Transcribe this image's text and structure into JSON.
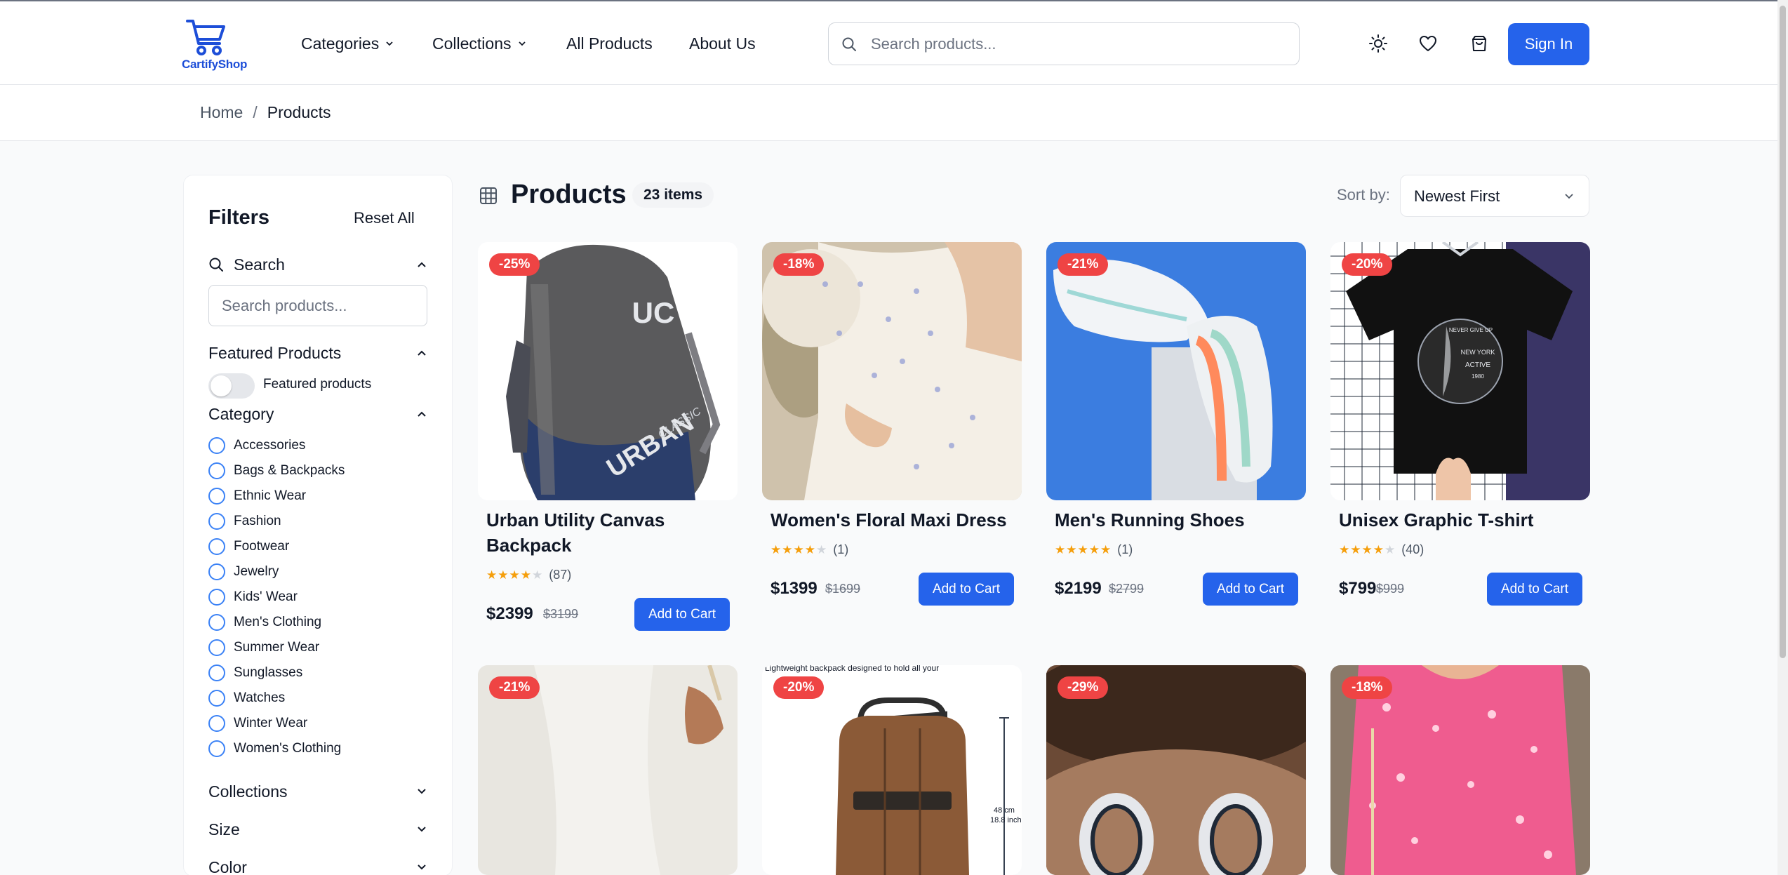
{
  "brand": {
    "name": "CartifyShop",
    "accent": "#2563eb"
  },
  "nav": {
    "categories": "Categories",
    "collections": "Collections",
    "all_products": "All Products",
    "about": "About Us"
  },
  "header": {
    "search_placeholder": "Search products...",
    "icons": [
      "sun-icon",
      "heart-icon",
      "shopping-bag-icon"
    ],
    "sign_in": "Sign In"
  },
  "breadcrumb": {
    "home": "Home",
    "separator": "/",
    "current": "Products"
  },
  "filters": {
    "title": "Filters",
    "reset": "Reset All",
    "search_label": "Search",
    "search_placeholder": "Search products...",
    "featured_label": "Featured Products",
    "featured_toggle_label": "Featured products",
    "category_label": "Category",
    "categories": [
      "Accessories",
      "Bags & Backpacks",
      "Ethnic Wear",
      "Fashion",
      "Footwear",
      "Jewelry",
      "Kids' Wear",
      "Men's Clothing",
      "Summer Wear",
      "Sunglasses",
      "Watches",
      "Winter Wear",
      "Women's Clothing"
    ],
    "collections_label": "Collections",
    "size_label": "Size",
    "color_label": "Color"
  },
  "products_header": {
    "title": "Products",
    "count": "23 items",
    "sort_label": "Sort by:",
    "sort_value": "Newest First"
  },
  "products": [
    {
      "name": "Urban Utility Canvas Backpack",
      "discount": "-25%",
      "rating": 4,
      "reviews": "(87)",
      "price": "$2399",
      "old_price": "$3199",
      "cta": "Add to Cart"
    },
    {
      "name": "Women's Floral Maxi Dress",
      "discount": "-18%",
      "rating": 4,
      "reviews": "(1)",
      "price": "$1399",
      "old_price": "$1699",
      "cta": "Add to Cart"
    },
    {
      "name": "Men's Running Shoes",
      "discount": "-21%",
      "rating": 5,
      "reviews": "(1)",
      "price": "$2199",
      "old_price": "$2799",
      "cta": "Add to Cart"
    },
    {
      "name": "Unisex Graphic T-shirt",
      "discount": "-20%",
      "rating": 4,
      "reviews": "(40)",
      "price": "$799",
      "old_price": "$999",
      "cta": "Add to Cart"
    },
    {
      "discount": "-21%"
    },
    {
      "discount": "-20%",
      "image_text": "Lightweight backpack designed to hold all your",
      "dim1": "48 cm",
      "dim2": "18.8 inch"
    },
    {
      "discount": "-29%"
    },
    {
      "discount": "-18%"
    }
  ],
  "product_images": {
    "backpack_text_top": "UC",
    "backpack_text_main": "URBAN",
    "backpack_text_sub": "CLASSIC",
    "tshirt_text_1": "NEVER GIVE UP",
    "tshirt_text_2": "NEW YORK",
    "tshirt_text_3": "ACTIVE",
    "tshirt_text_4": "1980"
  }
}
